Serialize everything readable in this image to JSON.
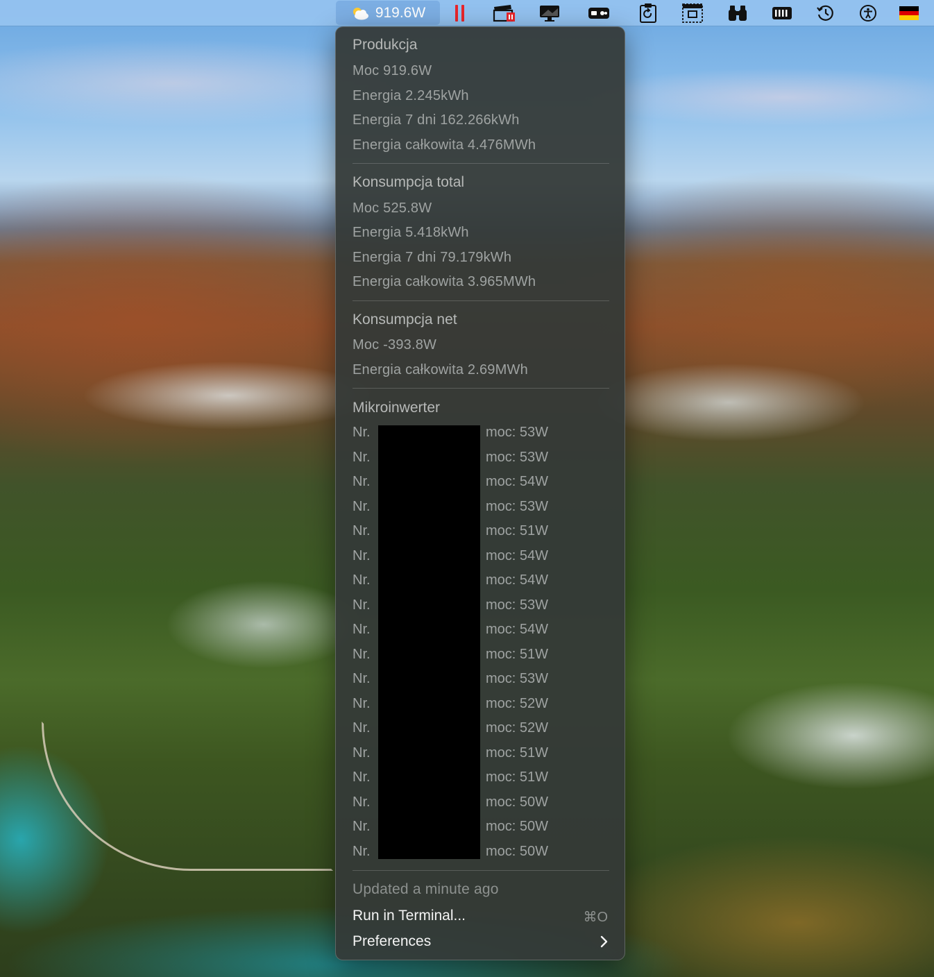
{
  "menubar": {
    "status_title": "919.6W",
    "icons": [
      "weather-cloud-icon",
      "pause-bars-icon",
      "clapperboard-icon",
      "display-icon",
      "gamepad-icon",
      "clipboard-icon",
      "window-capture-icon",
      "binoculars-icon",
      "memory-icon",
      "time-machine-icon",
      "accessibility-icon",
      "german-flag-icon"
    ]
  },
  "menu": {
    "produkcja": {
      "title": "Produkcja",
      "lines": [
        "Moc 919.6W",
        "Energia 2.245kWh",
        "Energia 7 dni 162.266kWh",
        "Energia całkowita 4.476MWh"
      ]
    },
    "konsumpcja_total": {
      "title": "Konsumpcja total",
      "lines": [
        "Moc 525.8W",
        "Energia 5.418kWh",
        "Energia 7 dni 79.179kWh",
        "Energia całkowita 3.965MWh"
      ]
    },
    "konsumpcja_net": {
      "title": "Konsumpcja net",
      "lines": [
        "Moc -393.8W",
        "Energia całkowita 2.69MWh"
      ]
    },
    "mikroinwerter": {
      "title": "Mikroinwerter",
      "prefix": "Nr.",
      "powers": [
        "moc: 53W",
        "moc: 53W",
        "moc: 54W",
        "moc: 53W",
        "moc: 51W",
        "moc: 54W",
        "moc: 54W",
        "moc: 53W",
        "moc: 54W",
        "moc: 51W",
        "moc: 53W",
        "moc: 52W",
        "moc: 52W",
        "moc: 51W",
        "moc: 51W",
        "moc: 50W",
        "moc: 50W",
        "moc: 50W"
      ]
    },
    "updated": "Updated a minute ago",
    "run_in_terminal": "Run in Terminal...",
    "run_shortcut": "⌘O",
    "preferences": "Preferences"
  },
  "colors": {
    "menubar_bg": "#96c3f0",
    "menu_bg": "#343937",
    "pause_red": "#e8262b",
    "flag_black": "#000000",
    "flag_red": "#dd0000",
    "flag_gold": "#ffce00"
  }
}
